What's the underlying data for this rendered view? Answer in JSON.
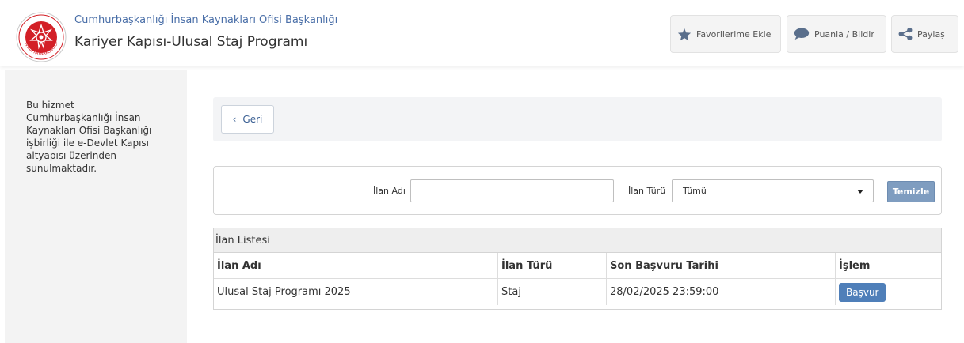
{
  "header": {
    "org_name": "Cumhurbaşkanlığı İnsan Kaynakları Ofisi Başkanlığı",
    "service_title": "Kariyer Kapısı-Ulusal Staj Programı",
    "logo_text": "İNSAN KAYNAKLARI OFİSİ",
    "buttons": {
      "favorites": "Favorilerime Ekle",
      "rate": "Puanla / Bildir",
      "share": "Paylaş"
    }
  },
  "sidebar": {
    "info_text": "Bu hizmet Cumhurbaşkanlığı İnsan Kaynakları Ofisi Başkanlığı işbirliği ile e-Devlet Kapısı altyapısı üzerinden sunulmaktadır."
  },
  "main": {
    "back_label": "Geri",
    "filters": {
      "name_label": "İlan Adı",
      "name_value": "",
      "type_label": "İlan Türü",
      "type_selected": "Tümü",
      "clear_label": "Temizle"
    },
    "list": {
      "title": "İlan Listesi",
      "columns": [
        "İlan Adı",
        "İlan Türü",
        "Son Başvuru Tarihi",
        "İşlem"
      ],
      "rows": [
        {
          "name": "Ulusal Staj Programı 2025",
          "type": "Staj",
          "deadline": "28/02/2025 23:59:00",
          "action": "Başvur"
        }
      ]
    }
  },
  "colors": {
    "accent": "#4f7fb9",
    "logo_red": "#d32027",
    "org_link": "#4a6fa8"
  },
  "icons": [
    "star-icon",
    "speech-bubble-icon",
    "share-icon",
    "chevron-left-icon",
    "caret-down-icon"
  ]
}
